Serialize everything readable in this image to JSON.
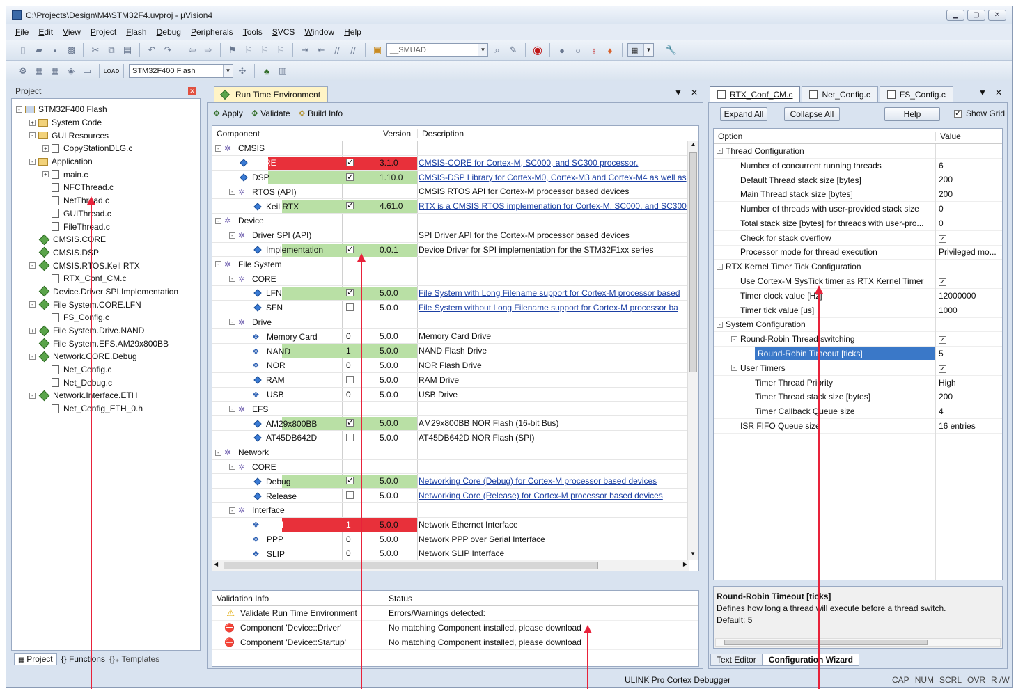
{
  "window": {
    "title": "C:\\Projects\\Design\\M4\\STM32F4.uvproj - µVision4"
  },
  "menu": [
    "File",
    "Edit",
    "View",
    "Project",
    "Flash",
    "Debug",
    "Peripherals",
    "Tools",
    "SVCS",
    "Window",
    "Help"
  ],
  "toolbar": {
    "smuad_value": "__SMUAD",
    "target_value": "STM32F400 Flash",
    "load_label": "LOAD"
  },
  "project_panel": {
    "title": "Project",
    "tree": [
      {
        "label": "STM32F400 Flash",
        "level": 0,
        "exp": "-",
        "icon": "target"
      },
      {
        "label": "System Code",
        "level": 1,
        "exp": "+",
        "icon": "folder"
      },
      {
        "label": "GUI Resources",
        "level": 1,
        "exp": "-",
        "icon": "folder"
      },
      {
        "label": "CopyStationDLG.c",
        "level": 2,
        "exp": "+",
        "icon": "file"
      },
      {
        "label": "Application",
        "level": 1,
        "exp": "-",
        "icon": "folder"
      },
      {
        "label": "main.c",
        "level": 2,
        "exp": "+",
        "icon": "file"
      },
      {
        "label": "NFCThread.c",
        "level": 2,
        "exp": "",
        "icon": "file"
      },
      {
        "label": "NetThread.c",
        "level": 2,
        "exp": "",
        "icon": "file"
      },
      {
        "label": "GUIThread.c",
        "level": 2,
        "exp": "",
        "icon": "file"
      },
      {
        "label": "FileThread.c",
        "level": 2,
        "exp": "",
        "icon": "file"
      },
      {
        "label": "CMSIS.CORE",
        "level": 1,
        "exp": "",
        "icon": "gem"
      },
      {
        "label": "CMSIS.DSP",
        "level": 1,
        "exp": "",
        "icon": "gem"
      },
      {
        "label": "CMSIS.RTOS.Keil RTX",
        "level": 1,
        "exp": "-",
        "icon": "gem"
      },
      {
        "label": "RTX_Conf_CM.c",
        "level": 2,
        "exp": "",
        "icon": "file"
      },
      {
        "label": "Device.Driver SPI.Implementation",
        "level": 1,
        "exp": "",
        "icon": "gem"
      },
      {
        "label": "File System.CORE.LFN",
        "level": 1,
        "exp": "-",
        "icon": "gem"
      },
      {
        "label": "FS_Config.c",
        "level": 2,
        "exp": "",
        "icon": "file"
      },
      {
        "label": "File System.Drive.NAND",
        "level": 1,
        "exp": "+",
        "icon": "gem"
      },
      {
        "label": "File System.EFS.AM29x800BB",
        "level": 1,
        "exp": "",
        "icon": "gem"
      },
      {
        "label": "Network.CORE.Debug",
        "level": 1,
        "exp": "-",
        "icon": "gem"
      },
      {
        "label": "Net_Config.c",
        "level": 2,
        "exp": "",
        "icon": "file"
      },
      {
        "label": "Net_Debug.c",
        "level": 2,
        "exp": "",
        "icon": "file"
      },
      {
        "label": "Network.Interface.ETH",
        "level": 1,
        "exp": "-",
        "icon": "gem"
      },
      {
        "label": "Net_Config_ETH_0.h",
        "level": 2,
        "exp": "",
        "icon": "file"
      }
    ],
    "bottom_tabs": [
      "Project",
      "Functions",
      "Templates"
    ]
  },
  "rte": {
    "tab_label": "Run Time Environment",
    "buttons": [
      "Apply",
      "Validate",
      "Build Info"
    ],
    "columns": [
      "Component",
      "Version",
      "Description"
    ],
    "rows": [
      {
        "name": "CMSIS",
        "level": 0,
        "exp": "-",
        "icon": "gear",
        "sel": "",
        "ver": "",
        "desc": "",
        "link": false,
        "bg": ""
      },
      {
        "name": "CORE",
        "level": 1,
        "exp": "",
        "icon": "diamond",
        "sel": "check",
        "ver": "3.1.0",
        "desc": "CMSIS-CORE for Cortex-M, SC000, and SC300 processor.",
        "link": true,
        "bg": "red"
      },
      {
        "name": "DSP",
        "level": 1,
        "exp": "",
        "icon": "diamond",
        "sel": "check",
        "ver": "1.10.0",
        "desc": "CMSIS-DSP Library for Cortex-M0, Cortex-M3 and Cortex-M4 as well as",
        "link": true,
        "bg": "green"
      },
      {
        "name": "RTOS (API)",
        "level": 1,
        "exp": "-",
        "icon": "gear",
        "sel": "",
        "ver": "",
        "desc": "CMSIS RTOS API for Cortex-M processor based devices",
        "link": false,
        "bg": ""
      },
      {
        "name": "Keil RTX",
        "level": 2,
        "exp": "",
        "icon": "diamond",
        "sel": "check",
        "ver": "4.61.0",
        "desc": "RTX is a CMSIS RTOS implemenation for Cortex-M, SC000, and SC300 p",
        "link": true,
        "bg": "green"
      },
      {
        "name": "Device",
        "level": 0,
        "exp": "-",
        "icon": "gear",
        "sel": "",
        "ver": "",
        "desc": "",
        "link": false,
        "bg": ""
      },
      {
        "name": "Driver SPI (API)",
        "level": 1,
        "exp": "-",
        "icon": "gear",
        "sel": "",
        "ver": "",
        "desc": "SPI Driver API for the Cortex-M processor based devices",
        "link": false,
        "bg": ""
      },
      {
        "name": "Implementation",
        "level": 2,
        "exp": "",
        "icon": "diamond",
        "sel": "check",
        "ver": "0.0.1",
        "desc": "Device Driver for SPI implementation for the STM32F1xx series",
        "link": false,
        "bg": "green"
      },
      {
        "name": "File System",
        "level": 0,
        "exp": "-",
        "icon": "gear",
        "sel": "",
        "ver": "",
        "desc": "",
        "link": false,
        "bg": ""
      },
      {
        "name": "CORE",
        "level": 1,
        "exp": "-",
        "icon": "gear",
        "sel": "",
        "ver": "",
        "desc": "",
        "link": false,
        "bg": ""
      },
      {
        "name": "LFN",
        "level": 2,
        "exp": "",
        "icon": "diamond",
        "sel": "check",
        "ver": "5.0.0",
        "desc": "File System with Long Filename support for Cortex-M processor based",
        "link": true,
        "bg": "green"
      },
      {
        "name": "SFN",
        "level": 2,
        "exp": "",
        "icon": "diamond",
        "sel": "empty",
        "ver": "5.0.0",
        "desc": "File System without Long Filename support for Cortex-M processor ba",
        "link": true,
        "bg": ""
      },
      {
        "name": "Drive",
        "level": 1,
        "exp": "-",
        "icon": "gear",
        "sel": "",
        "ver": "",
        "desc": "",
        "link": false,
        "bg": ""
      },
      {
        "name": "Memory Card",
        "level": 2,
        "exp": "",
        "icon": "multi",
        "sel": "0",
        "ver": "5.0.0",
        "desc": "Memory Card Drive",
        "link": false,
        "bg": ""
      },
      {
        "name": "NAND",
        "level": 2,
        "exp": "",
        "icon": "multi",
        "sel": "1",
        "ver": "5.0.0",
        "desc": "NAND Flash Drive",
        "link": false,
        "bg": "green"
      },
      {
        "name": "NOR",
        "level": 2,
        "exp": "",
        "icon": "multi",
        "sel": "0",
        "ver": "5.0.0",
        "desc": "NOR Flash Drive",
        "link": false,
        "bg": ""
      },
      {
        "name": "RAM",
        "level": 2,
        "exp": "",
        "icon": "diamond",
        "sel": "empty",
        "ver": "5.0.0",
        "desc": "RAM Drive",
        "link": false,
        "bg": ""
      },
      {
        "name": "USB",
        "level": 2,
        "exp": "",
        "icon": "multi",
        "sel": "0",
        "ver": "5.0.0",
        "desc": "USB Drive",
        "link": false,
        "bg": ""
      },
      {
        "name": "EFS",
        "level": 1,
        "exp": "-",
        "icon": "gear",
        "sel": "",
        "ver": "",
        "desc": "",
        "link": false,
        "bg": ""
      },
      {
        "name": "AM29x800BB",
        "level": 2,
        "exp": "",
        "icon": "diamond",
        "sel": "check",
        "ver": "5.0.0",
        "desc": "AM29x800BB NOR Flash (16-bit Bus)",
        "link": false,
        "bg": "green"
      },
      {
        "name": "AT45DB642D",
        "level": 2,
        "exp": "",
        "icon": "diamond",
        "sel": "empty",
        "ver": "5.0.0",
        "desc": "AT45DB642D NOR Flash (SPI)",
        "link": false,
        "bg": ""
      },
      {
        "name": "Network",
        "level": 0,
        "exp": "-",
        "icon": "gear",
        "sel": "",
        "ver": "",
        "desc": "",
        "link": false,
        "bg": ""
      },
      {
        "name": "CORE",
        "level": 1,
        "exp": "-",
        "icon": "gear",
        "sel": "",
        "ver": "",
        "desc": "",
        "link": false,
        "bg": ""
      },
      {
        "name": "Debug",
        "level": 2,
        "exp": "",
        "icon": "diamond",
        "sel": "check",
        "ver": "5.0.0",
        "desc": "Networking Core (Debug) for Cortex-M processor based devices",
        "link": true,
        "bg": "green"
      },
      {
        "name": "Release",
        "level": 2,
        "exp": "",
        "icon": "diamond",
        "sel": "empty",
        "ver": "5.0.0",
        "desc": "Networking Core (Release) for Cortex-M processor based devices",
        "link": true,
        "bg": ""
      },
      {
        "name": "Interface",
        "level": 1,
        "exp": "-",
        "icon": "gear",
        "sel": "",
        "ver": "",
        "desc": "",
        "link": false,
        "bg": ""
      },
      {
        "name": "ETH",
        "level": 2,
        "exp": "",
        "icon": "multi",
        "sel": "1",
        "ver": "5.0.0",
        "desc": "Network Ethernet Interface",
        "link": false,
        "bg": "red"
      },
      {
        "name": "PPP",
        "level": 2,
        "exp": "",
        "icon": "multi",
        "sel": "0",
        "ver": "5.0.0",
        "desc": "Network PPP over Serial Interface",
        "link": false,
        "bg": ""
      },
      {
        "name": "SLIP",
        "level": 2,
        "exp": "",
        "icon": "multi",
        "sel": "0",
        "ver": "5.0.0",
        "desc": "Network SLIP Interface",
        "link": false,
        "bg": ""
      }
    ],
    "validation": {
      "columns": [
        "Validation Info",
        "Status"
      ],
      "rows": [
        {
          "icon": "warning",
          "info": "Validate Run Time Environment",
          "status": "Errors/Warnings detected:"
        },
        {
          "icon": "error",
          "info": "Component 'Device::Driver'",
          "status": "No matching Component installed, please download"
        },
        {
          "icon": "error",
          "info": "Component 'Device::Startup'",
          "status": "No matching Component installed, please download"
        }
      ]
    }
  },
  "config": {
    "tabs": [
      "RTX_Conf_CM.c",
      "Net_Config.c",
      "FS_Config.c"
    ],
    "buttons": {
      "expand": "Expand All",
      "collapse": "Collapse All",
      "help": "Help",
      "grid": "Show Grid"
    },
    "columns": [
      "Option",
      "Value"
    ],
    "rows": [
      {
        "label": "Thread Configuration",
        "level": 0,
        "exp": "-",
        "value": "",
        "vtype": "",
        "sel": false
      },
      {
        "label": "Number of concurrent running threads",
        "level": 1,
        "exp": "",
        "value": "6",
        "vtype": "text",
        "sel": false
      },
      {
        "label": "Default Thread stack size [bytes]",
        "level": 1,
        "exp": "",
        "value": "200",
        "vtype": "text",
        "sel": false
      },
      {
        "label": "Main Thread stack size [bytes]",
        "level": 1,
        "exp": "",
        "value": "200",
        "vtype": "text",
        "sel": false
      },
      {
        "label": "Number of threads with user-provided stack size",
        "level": 1,
        "exp": "",
        "value": "0",
        "vtype": "text",
        "sel": false
      },
      {
        "label": "Total stack size [bytes] for threads with user-pro...",
        "level": 1,
        "exp": "",
        "value": "0",
        "vtype": "text",
        "sel": false
      },
      {
        "label": "Check for stack overflow",
        "level": 1,
        "exp": "",
        "value": "",
        "vtype": "check",
        "sel": false
      },
      {
        "label": "Processor mode for thread execution",
        "level": 1,
        "exp": "",
        "value": "Privileged mo...",
        "vtype": "text",
        "sel": false
      },
      {
        "label": "RTX Kernel Timer Tick Configuration",
        "level": 0,
        "exp": "-",
        "value": "",
        "vtype": "",
        "sel": false
      },
      {
        "label": "Use Cortex-M SysTick timer as RTX Kernel Timer",
        "level": 1,
        "exp": "",
        "value": "",
        "vtype": "check",
        "sel": false
      },
      {
        "label": "Timer clock value [Hz]",
        "level": 1,
        "exp": "",
        "value": "12000000",
        "vtype": "text",
        "sel": false
      },
      {
        "label": "Timer tick value [us]",
        "level": 1,
        "exp": "",
        "value": "1000",
        "vtype": "text",
        "sel": false
      },
      {
        "label": "System Configuration",
        "level": 0,
        "exp": "-",
        "value": "",
        "vtype": "",
        "sel": false
      },
      {
        "label": "Round-Robin Thread switching",
        "level": 1,
        "exp": "-",
        "value": "",
        "vtype": "check",
        "sel": false
      },
      {
        "label": "Round-Robin Timeout [ticks]",
        "level": 2,
        "exp": "",
        "value": "5",
        "vtype": "text",
        "sel": true
      },
      {
        "label": "User Timers",
        "level": 1,
        "exp": "-",
        "value": "",
        "vtype": "check",
        "sel": false
      },
      {
        "label": "Timer Thread Priority",
        "level": 2,
        "exp": "",
        "value": "High",
        "vtype": "text",
        "sel": false
      },
      {
        "label": "Timer Thread stack size [bytes]",
        "level": 2,
        "exp": "",
        "value": "200",
        "vtype": "text",
        "sel": false
      },
      {
        "label": "Timer Callback Queue size",
        "level": 2,
        "exp": "",
        "value": "4",
        "vtype": "text",
        "sel": false
      },
      {
        "label": "ISR FIFO Queue size",
        "level": 1,
        "exp": "",
        "value": "16 entries",
        "vtype": "text",
        "sel": false
      }
    ],
    "help_title": "Round-Robin Timeout [ticks]",
    "help_text": "Defines how long a thread will execute before a thread switch.",
    "help_default": "Default: 5",
    "bottom_tabs": [
      "Text Editor",
      "Configuration Wizard"
    ]
  },
  "status": {
    "debugger": "ULINK Pro Cortex Debugger",
    "indicators": [
      "CAP",
      "NUM",
      "SCRL",
      "OVR",
      "R /W"
    ]
  },
  "colors": {
    "red": "#e8303a",
    "green": "#b9e0a5",
    "selection": "#3a78c8",
    "arrow": "#e8223a"
  }
}
